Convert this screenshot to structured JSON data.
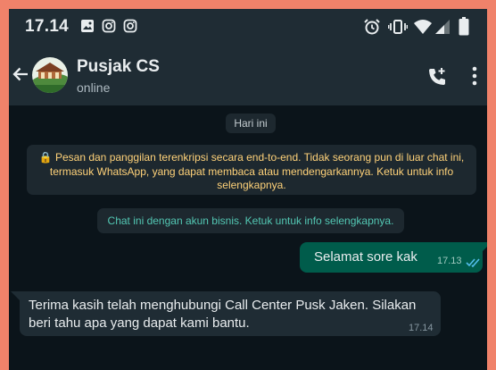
{
  "status_bar": {
    "time": "17.14",
    "left_icons": [
      "image-icon",
      "instagram-icon",
      "instagram-icon"
    ],
    "right_icons": [
      "alarm-icon",
      "vibrate-icon",
      "wifi-icon",
      "signal-icon",
      "battery-icon"
    ]
  },
  "header": {
    "contact_name": "Pusjak CS",
    "status": "online",
    "icons": [
      "back-arrow-icon",
      "add-call-icon",
      "more-vert-icon"
    ]
  },
  "chat": {
    "date_chip": "Hari ini",
    "encryption_notice": "🔒 Pesan dan panggilan terenkripsi secara end-to-end. Tidak seorang pun di luar chat ini, termasuk WhatsApp, yang dapat membaca atau mendengarkannya. Ketuk untuk info selengkapnya.",
    "business_notice": "Chat ini dengan akun bisnis. Ketuk untuk info selengkapnya.",
    "messages": [
      {
        "direction": "outgoing",
        "text": "Selamat sore kak",
        "time": "17.13",
        "status": "read"
      },
      {
        "direction": "incoming",
        "text": "Terima kasih telah menghubungi Call Center Pusk Jaken. Silakan beri tahu apa yang dapat kami bantu.",
        "time": "17.14"
      }
    ]
  },
  "colors": {
    "header_bg": "#1f2c34",
    "chat_bg": "#0b141a",
    "outgoing_bubble": "#005c4b",
    "incoming_bubble": "#1f2c34",
    "system_chip": "#1d282f",
    "encryption_text": "#ffd279",
    "business_text": "#53c7b3",
    "read_ticks": "#53bdeb",
    "frame": "#f0826a"
  }
}
